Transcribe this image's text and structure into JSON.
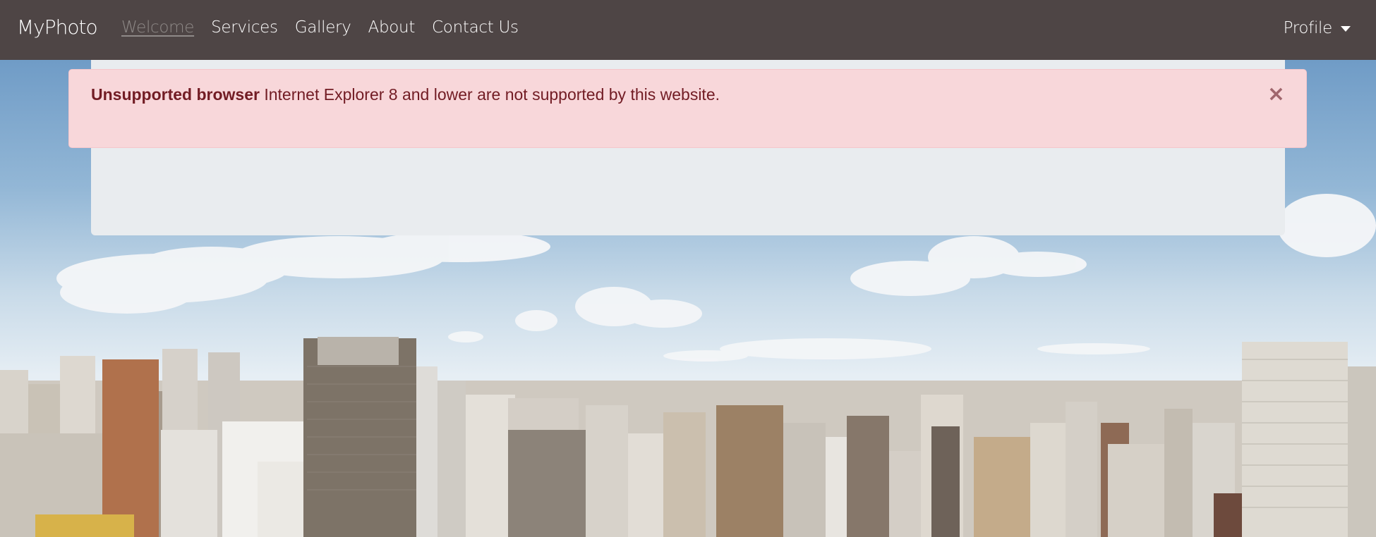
{
  "navbar": {
    "brand": "MyPhoto",
    "links": [
      {
        "label": "Welcome",
        "active": true
      },
      {
        "label": "Services",
        "active": false
      },
      {
        "label": "Gallery",
        "active": false
      },
      {
        "label": "About",
        "active": false
      },
      {
        "label": "Contact Us",
        "active": false
      }
    ],
    "profile_label": "Profile",
    "background_color": "#4e4545"
  },
  "alert": {
    "title": "Unsupported browser",
    "message": "Internet Explorer 8 and lower are not supported by this website.",
    "close_symbol": "×",
    "background_color": "#f8d7da",
    "text_color": "#721c24"
  },
  "jumbotron": {
    "background_color": "#e9ecef"
  },
  "hero": {
    "icon": "city-skyline-photo"
  }
}
